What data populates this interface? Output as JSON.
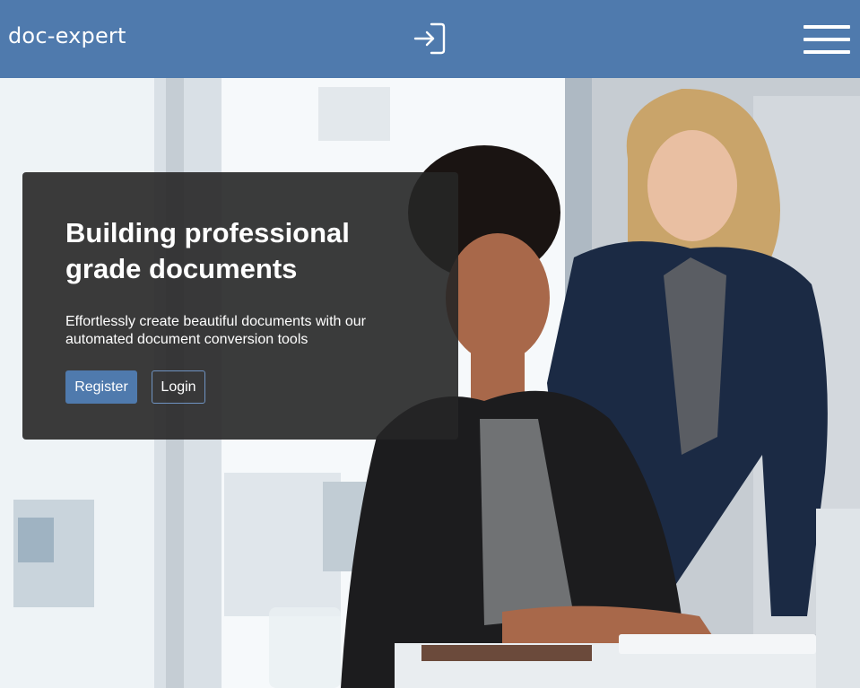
{
  "header": {
    "brand": "doc-expert",
    "login_icon": "login-arrow-icon",
    "menu_icon": "hamburger-menu-icon",
    "background_color": "#4f7aad"
  },
  "hero": {
    "title": "Building professional grade documents",
    "subtitle": "Effortlessly create beautiful documents with our automated document conversion tools",
    "register_label": "Register",
    "login_label": "Login",
    "card_color": "#262626",
    "accent_color": "#4f7aad"
  }
}
